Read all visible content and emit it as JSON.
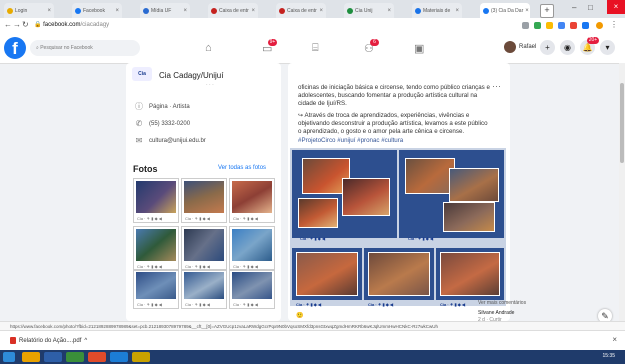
{
  "browser": {
    "tabs": [
      {
        "label": "Login",
        "color": "#e8ab00"
      },
      {
        "label": "Facebook",
        "color": "#1877f2"
      },
      {
        "label": "Mídia UF",
        "color": "#2a6bd1"
      },
      {
        "label": "Caixa de entr",
        "color": "#c5221f"
      },
      {
        "label": "Caixa de entr",
        "color": "#c5221f"
      },
      {
        "label": "Cia Unij",
        "color": "#1e8e3e"
      },
      {
        "label": "Materiais de",
        "color": "#1a73e8"
      },
      {
        "label": "(3) Cia Da Dar",
        "color": "#1877f2"
      }
    ],
    "new_tab_label": "+",
    "url_host": "facebook.com",
    "url_path": "/ciacadagy",
    "status_url": "https://www.facebook.com/photo/?fbid=2121892889978989&set=pcb.2121893078979789&__cft__[0]=AZVGUcp1zvaLaRWdgGcrPqx9N0bVqsoSMXfd3pnsGtxwqZgmdHmRKRb6wKJqlUmmHwHCNkC-Rz7wkCwUh"
  },
  "facebook": {
    "logo": "f",
    "search_placeholder": "Pesquisar no Facebook",
    "notif_badges": [
      "9+",
      "6"
    ],
    "user_name": "Rafael",
    "messenger_badge": "20+"
  },
  "profile": {
    "logo_text": "Cia",
    "page_name": "Cia Cadagy/Unijuí",
    "menu_dots": "· · ·",
    "info": [
      {
        "icon": "info-icon",
        "text": "Página · Artista"
      },
      {
        "icon": "phone-icon",
        "text": "(55) 3332-0200"
      },
      {
        "icon": "mail-icon",
        "text": "cultura@unijui.edu.br"
      }
    ]
  },
  "photos": {
    "title": "Fotos",
    "see_all": "Ver todas as fotos"
  },
  "post": {
    "text_lines": [
      "oficinas de iniciação básica e circense, tendo como público crianças e",
      "adolescentes, buscando fomentar a produção artística cultural na",
      "cidade de Ijuí/RS.",
      "↪ Através de troca de aprendizados, experiências, vivências e",
      "objetivando desconstruir a produção artística, levamos a este público",
      "o aprendizado, o gosto e o amor pela arte cênica e circense."
    ],
    "hashtags": "#ProjetoCirco #unijuí #pronac #cultura",
    "more": "···"
  },
  "reactions": {
    "emoji": "🙂",
    "side_text": "Ver mais comentários"
  },
  "comment": {
    "author": "Silvane Andrade",
    "meta": "2 d · Curtir"
  },
  "download": {
    "file": "Relatório do Ação....pdf",
    "caret": "^"
  },
  "taskbar": {
    "clock": "15:35",
    "apps": [
      "#e8a200",
      "#2e5fa8",
      "#3a8f3a",
      "#e04b2a",
      "#1c7dd6",
      "#c8a200"
    ]
  },
  "fab": "✎"
}
